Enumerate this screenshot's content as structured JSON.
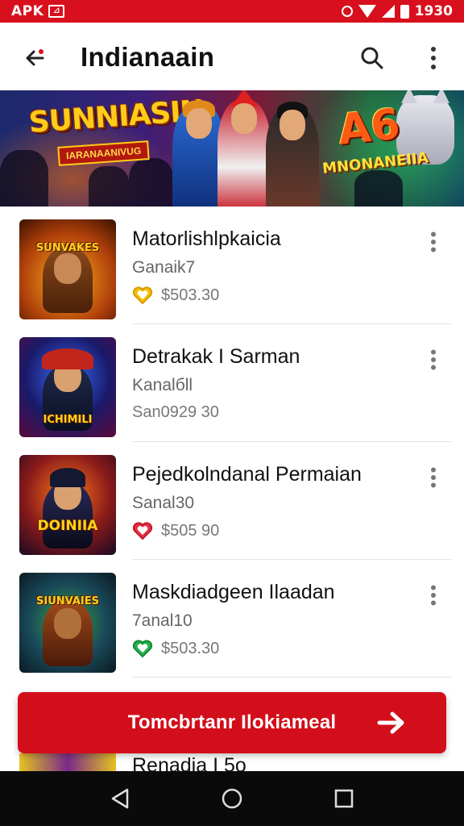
{
  "status_bar": {
    "left_label": "APK",
    "time": "1930"
  },
  "app_bar": {
    "title": "Indianaain"
  },
  "games": [
    {
      "title": "Matorlishlpkaicia",
      "subtitle": "Ganaik7",
      "price": "$503.30",
      "heart_color": "#f2c200"
    },
    {
      "title": "Detrakak I Sarman",
      "subtitle": "Kanalбll",
      "price": "San0929 30",
      "heart_color": ""
    },
    {
      "title": "Pejedkolndanal Permaian",
      "subtitle": "Sanal30",
      "price": "$505 90",
      "heart_color": "#e53245"
    },
    {
      "title": "Maskdiadgeen Ilaadan",
      "subtitle": "7anal10",
      "price": "$503.30",
      "heart_color": "#22b24a"
    }
  ],
  "banner": {
    "logo_left": "SUNNIASIN",
    "logo_left_sub": "IARANAANIVUG",
    "logo_right": "A6",
    "logo_right_sub": "MNONANEIIA"
  },
  "thumbs": [
    "SUNVAKES",
    "ICHIMILI",
    "DOINIIA",
    "SIUNVAIES"
  ],
  "cta": {
    "label": "Tomcbrtanr Ilokiameal"
  },
  "peek_item": {
    "title": "Renadia I 5o"
  },
  "colors": {
    "brand_red": "#d30e1b",
    "status_red": "#d8101d"
  }
}
